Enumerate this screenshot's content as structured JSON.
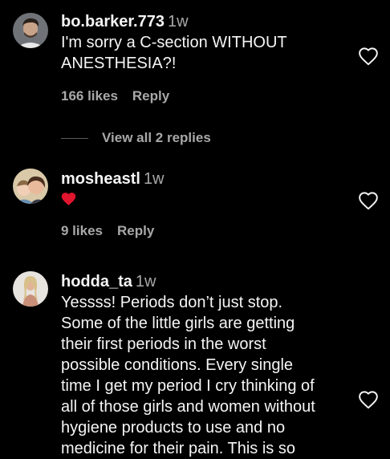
{
  "colors": {
    "background": "#000000",
    "text_primary": "#f5f5f5",
    "text_secondary": "#a8a8a8",
    "heart_emoji": "#e0152e"
  },
  "comments": [
    {
      "username": "bo.barker.773",
      "time": "1w",
      "text": "I'm sorry a C-section WITHOUT\nANESTHESIA?!",
      "likes": "166 likes",
      "reply_label": "Reply",
      "view_replies_label": "View all 2 replies",
      "like_icon": "heart-outline-icon"
    },
    {
      "username": "mosheastl",
      "time": "1w",
      "text_emoji": "red-heart-emoji",
      "likes": "9 likes",
      "reply_label": "Reply",
      "like_icon": "heart-outline-icon"
    },
    {
      "username": "hodda_ta",
      "time": "1w",
      "text": "Yessss! Periods don’t just stop.\nSome of the little girls are getting\ntheir first periods in the worst\npossible conditions. Every single\ntime I get my period I cry thinking of\nall of those girls and women without\nhygiene products to use and no\nmedicine for their pain. This is so",
      "like_icon": "heart-outline-icon"
    }
  ]
}
